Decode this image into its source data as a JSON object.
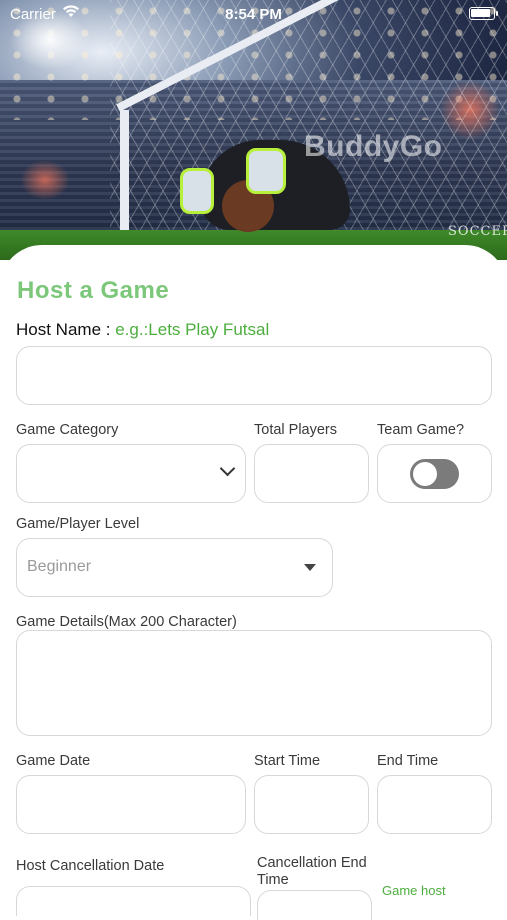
{
  "status_bar": {
    "carrier": "Carrier",
    "time": "8:54 PM"
  },
  "hero": {
    "watermark": "BuddyGo",
    "badge": "SOCCER"
  },
  "form": {
    "title": "Host a Game",
    "host_name_label": "Host Name : ",
    "host_name_hint": "e.g.:Lets Play Futsal",
    "host_name_value": "",
    "game_category_label": "Game Category",
    "game_category_value": "",
    "total_players_label": "Total Players",
    "total_players_value": "",
    "team_game_label": "Team Game?",
    "team_game_on": false,
    "level_label": "Game/Player Level",
    "level_value": "Beginner",
    "details_label": "Game Details(Max 200 Character)",
    "details_value": "",
    "game_date_label": "Game Date",
    "start_time_label": "Start Time",
    "end_time_label": "End Time",
    "host_cancel_label": "Host Cancellation Date",
    "cancel_end_label": "Cancellation End Time",
    "game_host_note": "Game host"
  },
  "colors": {
    "accent": "#7cc77a",
    "hint": "#4caf3d",
    "border": "#d8d8d8",
    "toggle_off": "#7b7b7b"
  }
}
